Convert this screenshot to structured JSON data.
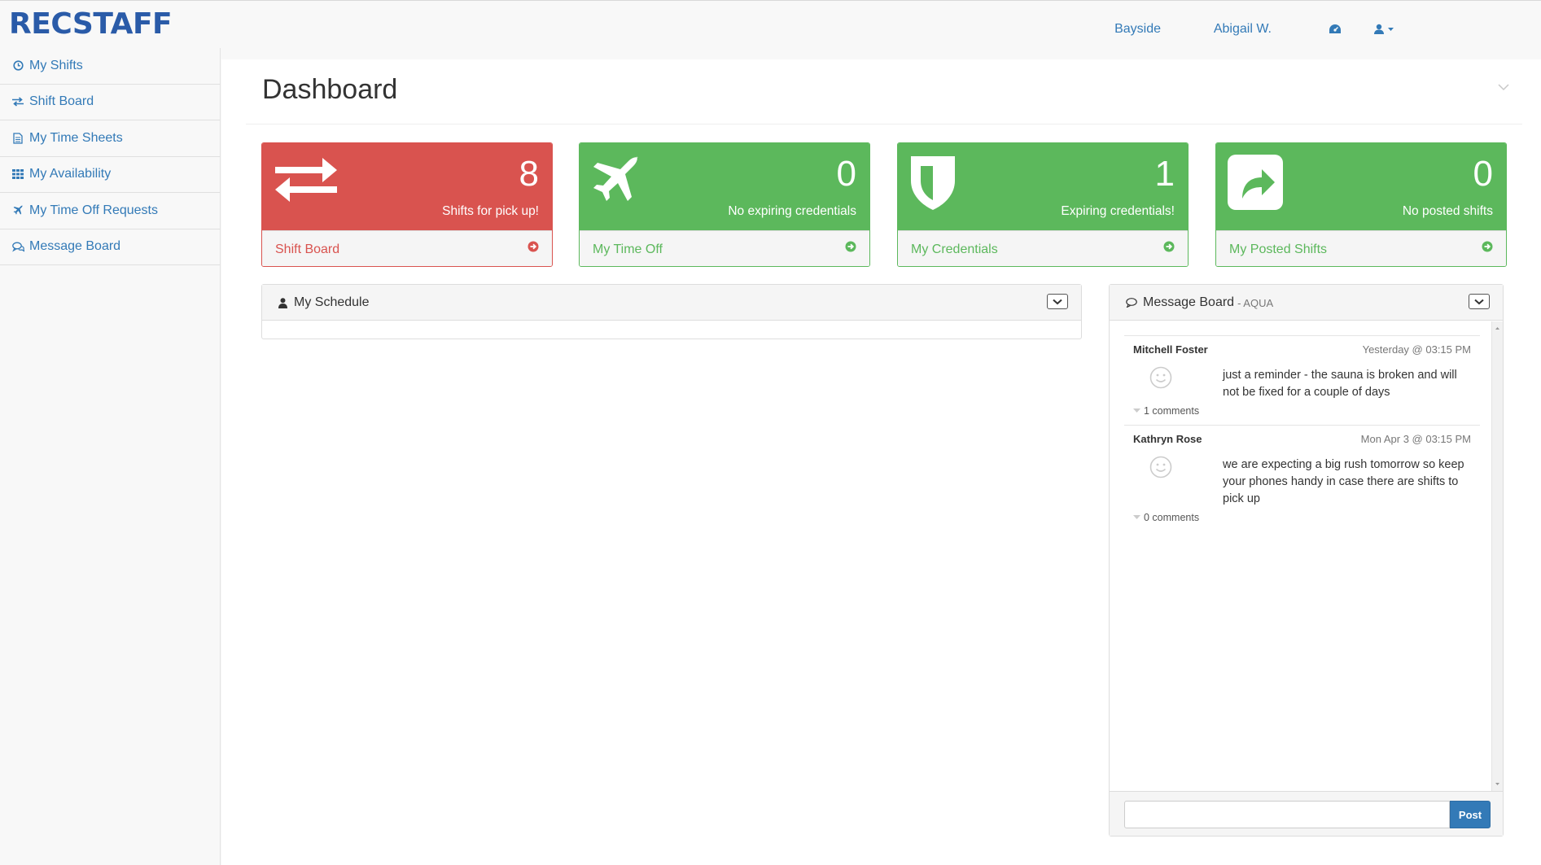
{
  "app": {
    "brand": "RECSTAFF",
    "location": "Bayside",
    "user_name": "Abigail W."
  },
  "sidebar": {
    "items": [
      {
        "label": "My Shifts",
        "icon": "clock-icon"
      },
      {
        "label": "Shift Board",
        "icon": "exchange-icon"
      },
      {
        "label": "My Time Sheets",
        "icon": "document-icon"
      },
      {
        "label": "My Availability",
        "icon": "grid-icon"
      },
      {
        "label": "My Time Off Requests",
        "icon": "plane-icon"
      },
      {
        "label": "Message Board",
        "icon": "comments-icon"
      }
    ]
  },
  "page": {
    "title": "Dashboard"
  },
  "cards": [
    {
      "count": "8",
      "label": "Shifts for pick up!",
      "link": "Shift Board",
      "color": "#d9534f",
      "icon": "exchange-icon"
    },
    {
      "count": "0",
      "label": "No expiring credentials",
      "link": "My Time Off",
      "color": "#5cb85c",
      "icon": "plane-icon"
    },
    {
      "count": "1",
      "label": "Expiring credentials!",
      "link": "My Credentials",
      "color": "#5cb85c",
      "icon": "shield-icon"
    },
    {
      "count": "0",
      "label": "No posted shifts",
      "link": "My Posted Shifts",
      "color": "#5cb85c",
      "icon": "share-icon"
    }
  ],
  "schedule": {
    "title": "My Schedule"
  },
  "message_board": {
    "title": "Message Board",
    "subtitle": "- AQUA",
    "messages": [
      {
        "author": "Mitchell Foster",
        "time": "Yesterday @ 03:15 PM",
        "text": "just a reminder - the sauna is broken and will not be fixed for a couple of days",
        "comments": "1 comments"
      },
      {
        "author": "Kathryn Rose",
        "time": "Mon Apr 3 @ 03:15 PM",
        "text": "we are expecting a big rush tomorrow so keep your phones handy in case there are shifts to pick up",
        "comments": "0 comments"
      }
    ],
    "input_value": "",
    "post_label": "Post"
  }
}
